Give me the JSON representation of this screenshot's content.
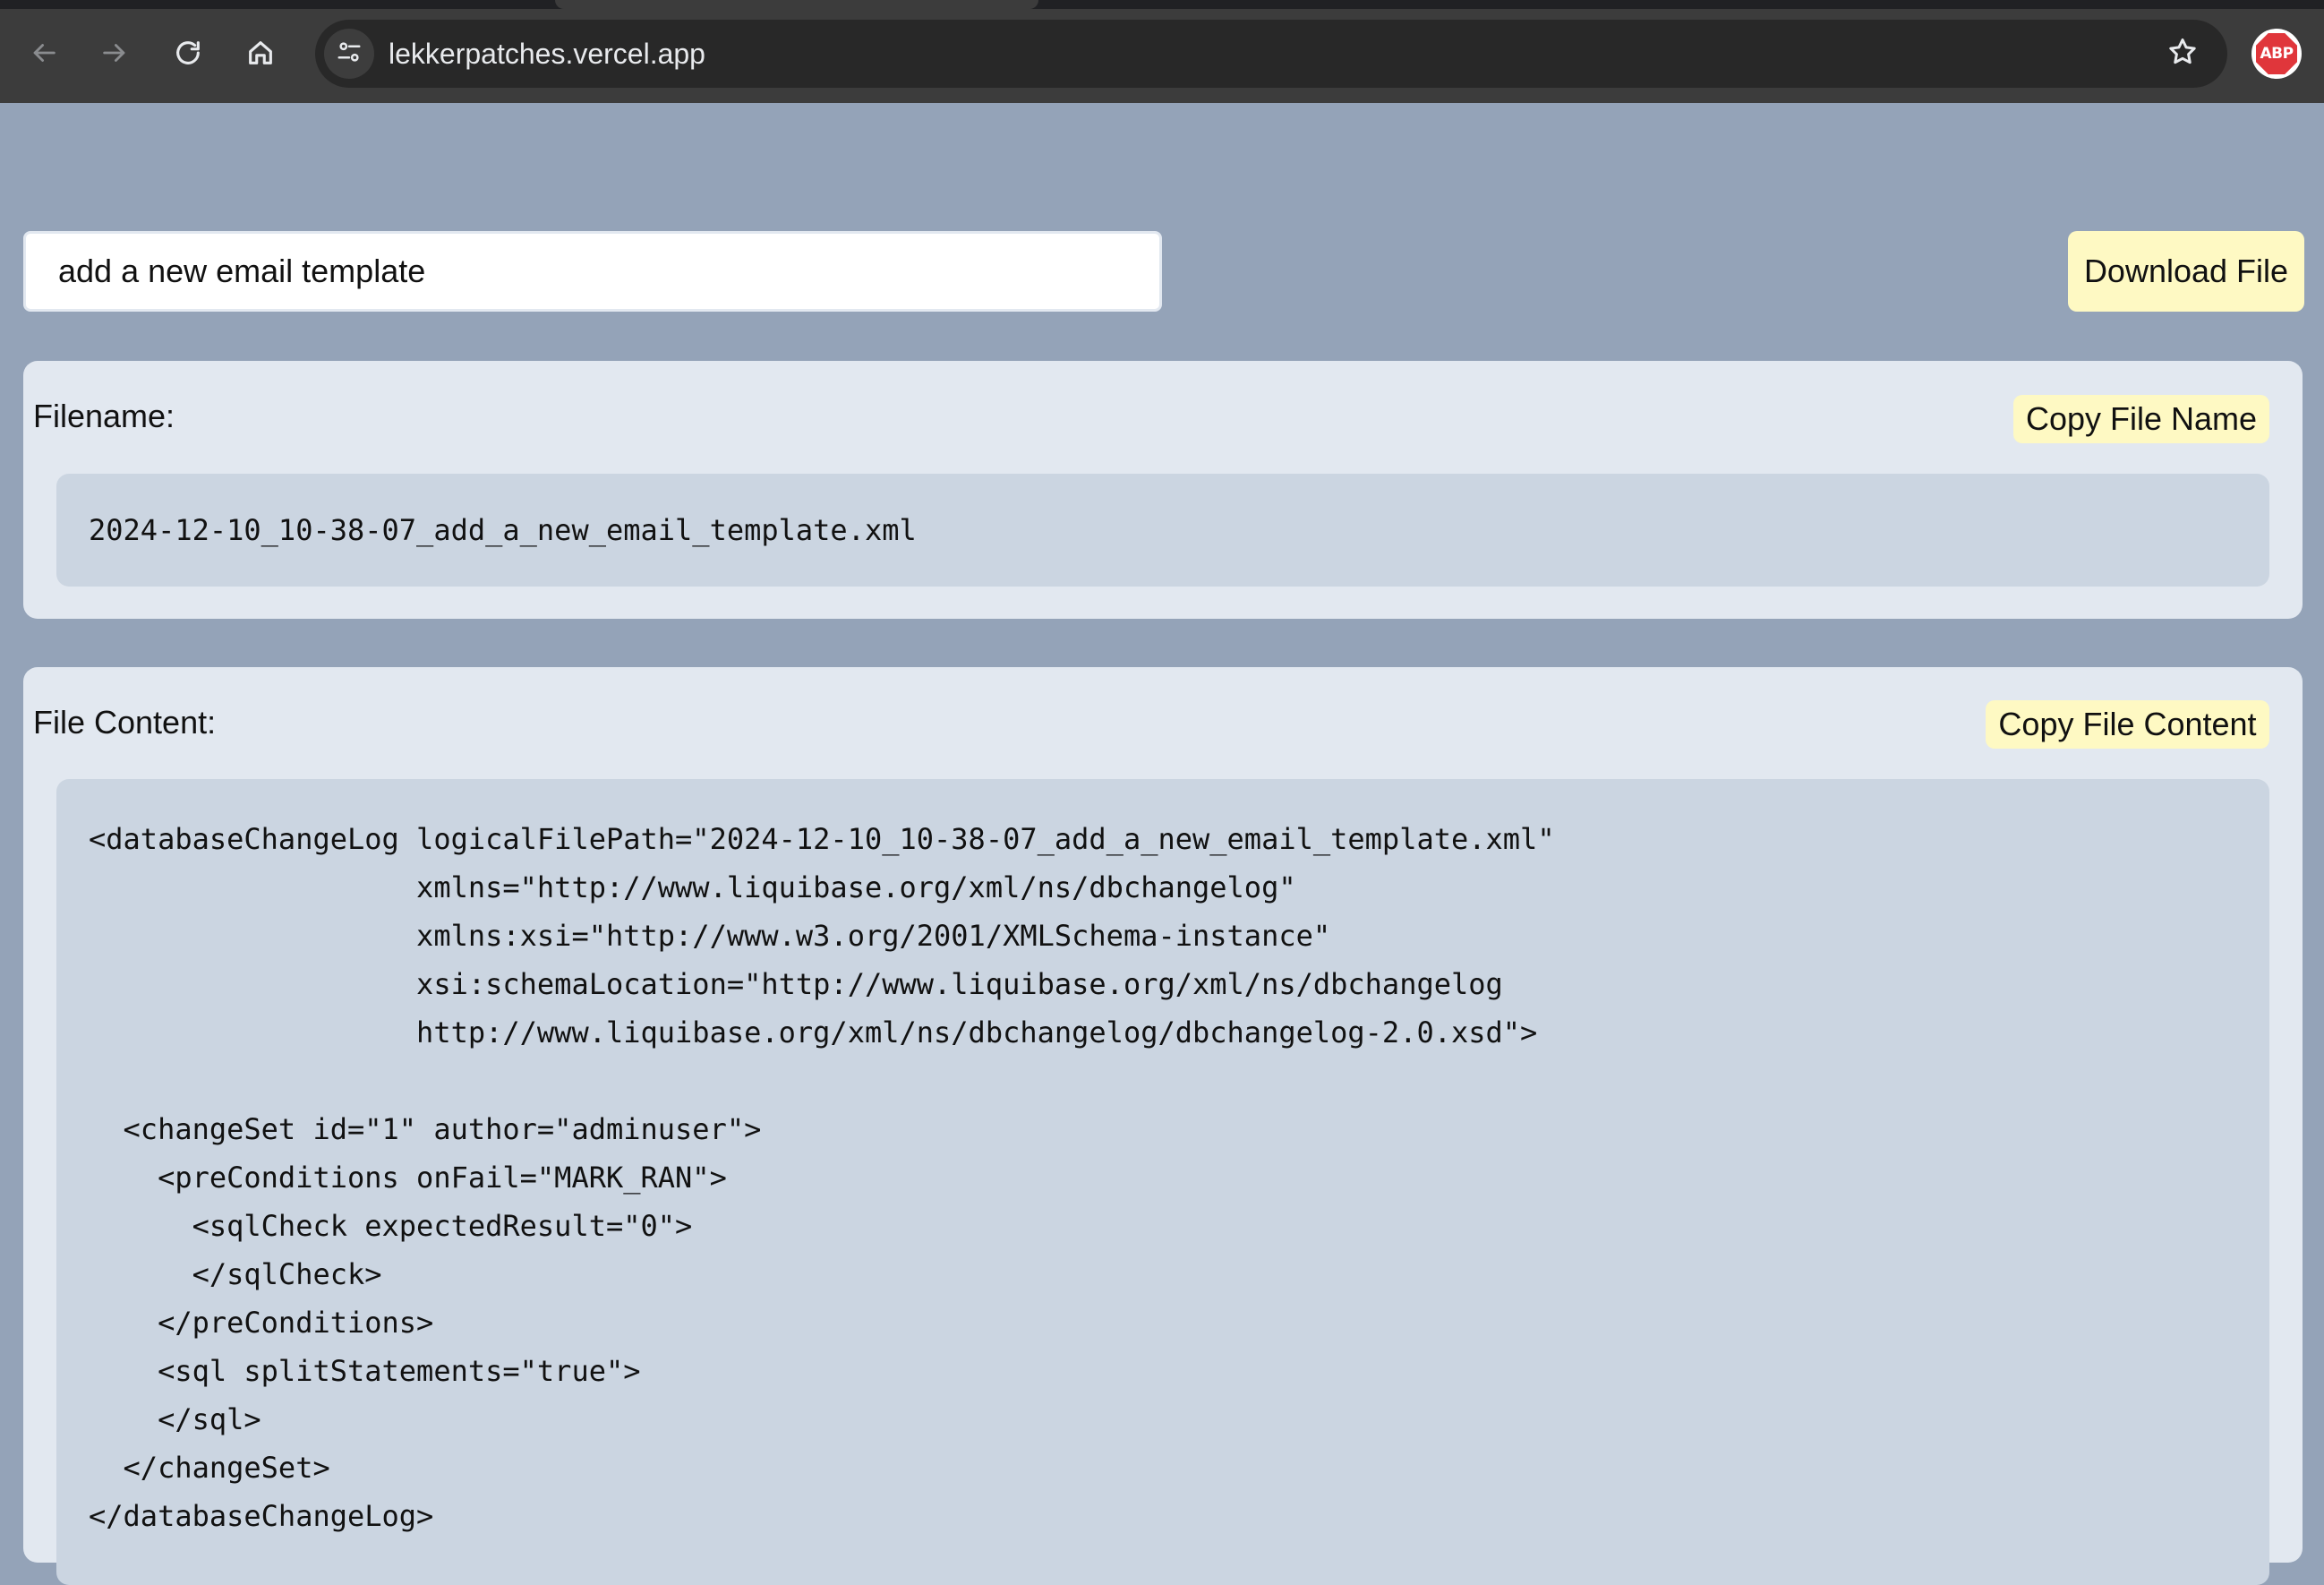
{
  "browser": {
    "url": "lekkerpatches.vercel.app",
    "extension_label": "ABP",
    "icons": {
      "back": "back-arrow-icon",
      "forward": "forward-arrow-icon",
      "reload": "reload-icon",
      "home": "home-icon",
      "site_info": "site-settings-icon",
      "bookmark": "star-icon",
      "extension": "adblock-plus-icon"
    }
  },
  "prompt": {
    "value": "add a new email template"
  },
  "actions": {
    "download_label": "Download File"
  },
  "filename_section": {
    "label": "Filename:",
    "copy_label": "Copy File Name",
    "value": "2024-12-10_10-38-07_add_a_new_email_template.xml"
  },
  "content_section": {
    "label": "File Content:",
    "copy_label": "Copy File Content",
    "value": "<databaseChangeLog logicalFilePath=\"2024-12-10_10-38-07_add_a_new_email_template.xml\"\n                   xmlns=\"http://www.liquibase.org/xml/ns/dbchangelog\"\n                   xmlns:xsi=\"http://www.w3.org/2001/XMLSchema-instance\"\n                   xsi:schemaLocation=\"http://www.liquibase.org/xml/ns/dbchangelog\n                   http://www.liquibase.org/xml/ns/dbchangelog/dbchangelog-2.0.xsd\">\n\n  <changeSet id=\"1\" author=\"adminuser\">\n    <preConditions onFail=\"MARK_RAN\">\n      <sqlCheck expectedResult=\"0\">\n      </sqlCheck>\n    </preConditions>\n    <sql splitStatements=\"true\">\n    </sql>\n  </changeSet>\n</databaseChangeLog>"
  },
  "colors": {
    "page_background": "#94a3b8",
    "card_background": "#e2e8f0",
    "code_background": "#cbd5e1",
    "button_background": "#fef9c3",
    "browser_chrome": "#3c3c3c",
    "omnibox": "#282828"
  }
}
